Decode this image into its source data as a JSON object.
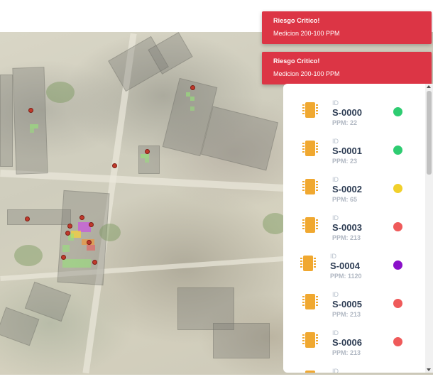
{
  "toasts": [
    {
      "title": "Riesgo Critico!",
      "message": "Medicion 200-100 PPM"
    },
    {
      "title": "Riesgo Critico!",
      "message": "Medicion 200-100 PPM"
    }
  ],
  "sensor_list": {
    "id_label": "ID",
    "items": [
      {
        "id": "S-0000",
        "ppm": "PPM: 22",
        "status_color": "#2ecc71"
      },
      {
        "id": "S-0001",
        "ppm": "PPM: 23",
        "status_color": "#2ecc71"
      },
      {
        "id": "S-0002",
        "ppm": "PPM: 65",
        "status_color": "#f1d02b"
      },
      {
        "id": "S-0003",
        "ppm": "PPM: 213",
        "status_color": "#ef5a5a"
      },
      {
        "id": "S-0004",
        "ppm": "PPM: 1120",
        "status_color": "#8a10c9"
      },
      {
        "id": "S-0005",
        "ppm": "PPM: 213",
        "status_color": "#ef5a5a"
      },
      {
        "id": "S-0006",
        "ppm": "PPM: 213",
        "status_color": "#ef5a5a"
      },
      {
        "id": "",
        "ppm": "",
        "status_color": "#ef5a5a"
      }
    ]
  },
  "icons": {
    "sensor": "chip-icon",
    "status": "status-dot-icon"
  },
  "colors": {
    "alert": "#dc3545",
    "chip": "#f0a830",
    "ok": "#2ecc71",
    "warn": "#f1d02b",
    "danger": "#ef5a5a",
    "extreme": "#8a10c9"
  }
}
